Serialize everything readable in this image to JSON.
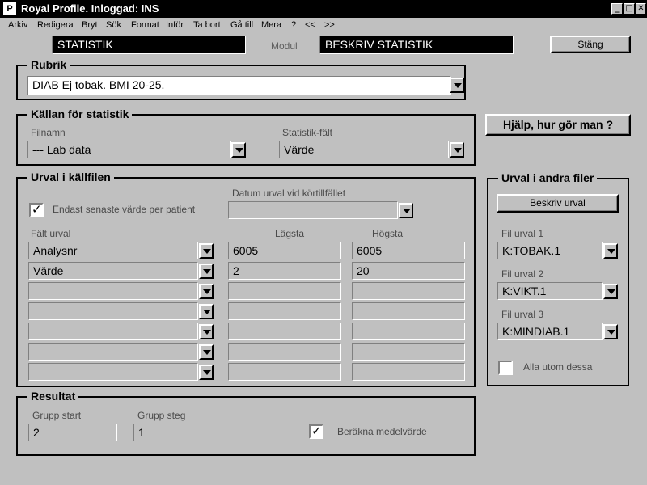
{
  "window": {
    "title": "Royal Profile. Inloggad:  INS",
    "icon_glyph": "P",
    "controls": [
      "_",
      "□",
      "✕"
    ]
  },
  "menu": [
    {
      "label": "Arkiv"
    },
    {
      "label": "Redigera"
    },
    {
      "label": "Bryt"
    },
    {
      "label": "Sök"
    },
    {
      "label": "Format"
    },
    {
      "label": "Inför"
    },
    {
      "label": "Ta bort"
    },
    {
      "label": "Gå till"
    },
    {
      "label": "Mera"
    },
    {
      "label": "?"
    },
    {
      "label": "<<"
    },
    {
      "label": ">>"
    }
  ],
  "header": {
    "left_title": "STATISTIK",
    "module_label": "Modul",
    "module_value": "BESKRIV STATISTIK",
    "close_button": "Stäng"
  },
  "rubrik": {
    "title": "Rubrik",
    "value": "DIAB Ej tobak. BMI 20-25."
  },
  "kallan": {
    "title": "Källan för statistik",
    "filnamn_label": "Filnamn",
    "filnamn_value": "--- Lab data",
    "statistik_falt_label": "Statistik-fält",
    "statistik_falt_value": "Värde"
  },
  "help_button": "Hjälp, hur gör man ?",
  "urval_kallfilen": {
    "title": "Urval i källfilen",
    "only_latest_label": "Endast senaste värde per patient",
    "only_latest_checked": true,
    "datum_label": "Datum urval vid körtillfället",
    "datum_value": "",
    "col_falt": "Fält urval",
    "col_lagsta": "Lägsta",
    "col_hogsta": "Högsta",
    "rows": [
      {
        "falt": "Analysnr",
        "lagsta": "6005",
        "hogsta": "6005"
      },
      {
        "falt": "Värde",
        "lagsta": "2",
        "hogsta": "20"
      },
      {
        "falt": "",
        "lagsta": "",
        "hogsta": ""
      },
      {
        "falt": "",
        "lagsta": "",
        "hogsta": ""
      },
      {
        "falt": "",
        "lagsta": "",
        "hogsta": ""
      },
      {
        "falt": "",
        "lagsta": "",
        "hogsta": ""
      },
      {
        "falt": "",
        "lagsta": "",
        "hogsta": ""
      }
    ]
  },
  "urval_andra": {
    "title": "Urval i andra filer",
    "describe_button": "Beskriv urval",
    "fil1_label": "Fil urval 1",
    "fil1_value": "K:TOBAK.1",
    "fil2_label": "Fil urval 2",
    "fil2_value": "K:VIKT.1",
    "fil3_label": "Fil urval 3",
    "fil3_value": "K:MINDIAB.1",
    "except_label": "Alla utom dessa",
    "except_checked": false
  },
  "resultat": {
    "title": "Resultat",
    "grupp_start_label": "Grupp start",
    "grupp_start_value": "2",
    "grupp_steg_label": "Grupp steg",
    "grupp_steg_value": "1",
    "calc_mean_label": "Beräkna medelvärde",
    "calc_mean_checked": true
  }
}
